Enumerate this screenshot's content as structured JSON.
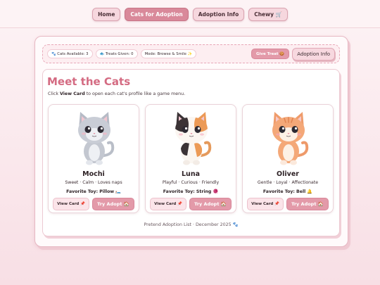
{
  "nav": {
    "items": [
      {
        "label": "Home",
        "active": false
      },
      {
        "label": "Cats for Adoption",
        "active": true
      },
      {
        "label": "Adoption Info",
        "active": false
      },
      {
        "label": "Chewy 🛒",
        "active": false
      }
    ]
  },
  "toolbar": {
    "cats_available": "🐾 Cats Available: 3",
    "treats_given": "🐟 Treats Given: 0",
    "mode": "Mode: Browse & Smile ✨",
    "give_treat": "Give Treat 🍪",
    "adoption_info": "Adoption Info"
  },
  "main": {
    "title": "Meet the Cats",
    "subtitle_pre": "Click ",
    "subtitle_bold": "View Card",
    "subtitle_post": " to open each cat's profile like a game menu.",
    "footer": "Pretend Adoption List · December 2025 🐾"
  },
  "cats": [
    {
      "name": "Mochi",
      "traits": "Sweet · Calm · Loves naps",
      "toy": "Favorite Toy: Pillow 🛏️",
      "view_label": "View Card 📌",
      "adopt_label": "Try Adopt 🏠",
      "coat": "gray"
    },
    {
      "name": "Luna",
      "traits": "Playful · Curious · Friendly",
      "toy": "Favorite Toy: String 🧶",
      "view_label": "View Card 📌",
      "adopt_label": "Try Adopt 🏠",
      "coat": "calico"
    },
    {
      "name": "Oliver",
      "traits": "Gentle · Loyal · Affectionate",
      "toy": "Favorite Toy: Bell 🔔",
      "view_label": "View Card 📌",
      "adopt_label": "Try Adopt 🏠",
      "coat": "orange"
    }
  ],
  "colors": {
    "accent": "#d9899a",
    "title": "#d46b82",
    "button": "#e39aa9",
    "background": "#fdf3f5"
  }
}
